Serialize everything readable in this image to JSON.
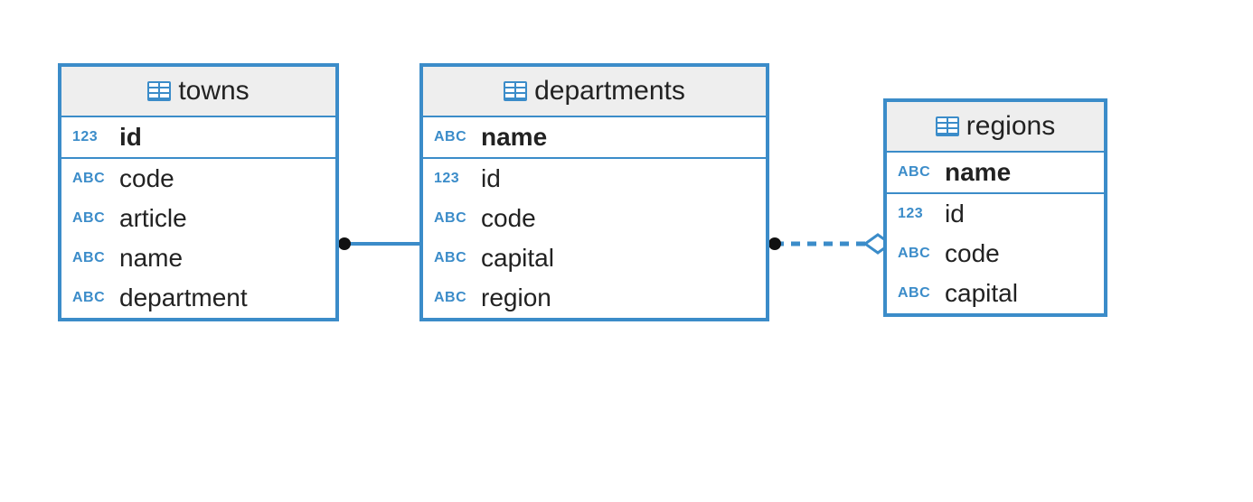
{
  "entities": {
    "towns": {
      "title": "towns",
      "pk": {
        "type": "123",
        "name": "id"
      },
      "cols": [
        {
          "type": "ABC",
          "name": "code"
        },
        {
          "type": "ABC",
          "name": "article"
        },
        {
          "type": "ABC",
          "name": "name"
        },
        {
          "type": "ABC",
          "name": "department"
        }
      ]
    },
    "departments": {
      "title": "departments",
      "pk": {
        "type": "ABC",
        "name": "name"
      },
      "cols": [
        {
          "type": "123",
          "name": "id"
        },
        {
          "type": "ABC",
          "name": "code"
        },
        {
          "type": "ABC",
          "name": "capital"
        },
        {
          "type": "ABC",
          "name": "region"
        }
      ]
    },
    "regions": {
      "title": "regions",
      "pk": {
        "type": "ABC",
        "name": "name"
      },
      "cols": [
        {
          "type": "123",
          "name": "id"
        },
        {
          "type": "ABC",
          "name": "code"
        },
        {
          "type": "ABC",
          "name": "capital"
        }
      ]
    }
  }
}
